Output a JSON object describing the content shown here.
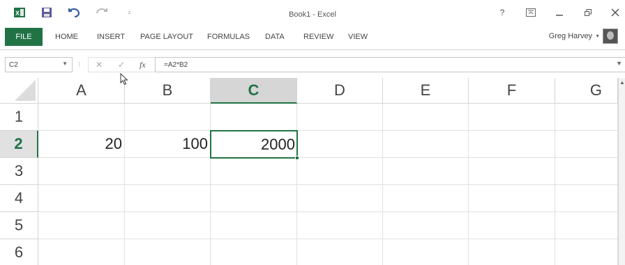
{
  "titlebar": {
    "title": "Book1 - Excel",
    "app_icon": "excel-logo-icon",
    "qat": [
      "save-icon",
      "undo-icon",
      "redo-icon",
      "customize-qat-icon"
    ],
    "window_buttons": [
      "?",
      "ribbon-display-options-icon",
      "minimize-icon",
      "restore-icon",
      "close-icon"
    ]
  },
  "ribbon": {
    "tabs": [
      "FILE",
      "HOME",
      "INSERT",
      "PAGE LAYOUT",
      "FORMULAS",
      "DATA",
      "REVIEW",
      "VIEW"
    ],
    "user_name": "Greg Harvey",
    "accent": "#217346"
  },
  "formula_bar": {
    "name_box": "C2",
    "formula": "=A2*B2",
    "cancel_symbol": "✕",
    "enter_symbol": "✓",
    "fx_label": "fx"
  },
  "sheet": {
    "columns": [
      "A",
      "B",
      "C",
      "D",
      "E",
      "F",
      "G"
    ],
    "rows": [
      "1",
      "2",
      "3",
      "4",
      "5",
      "6"
    ],
    "selected_column": "C",
    "selected_row": "2",
    "cells": {
      "A2": "20",
      "B2": "100",
      "C2": "2000"
    }
  }
}
